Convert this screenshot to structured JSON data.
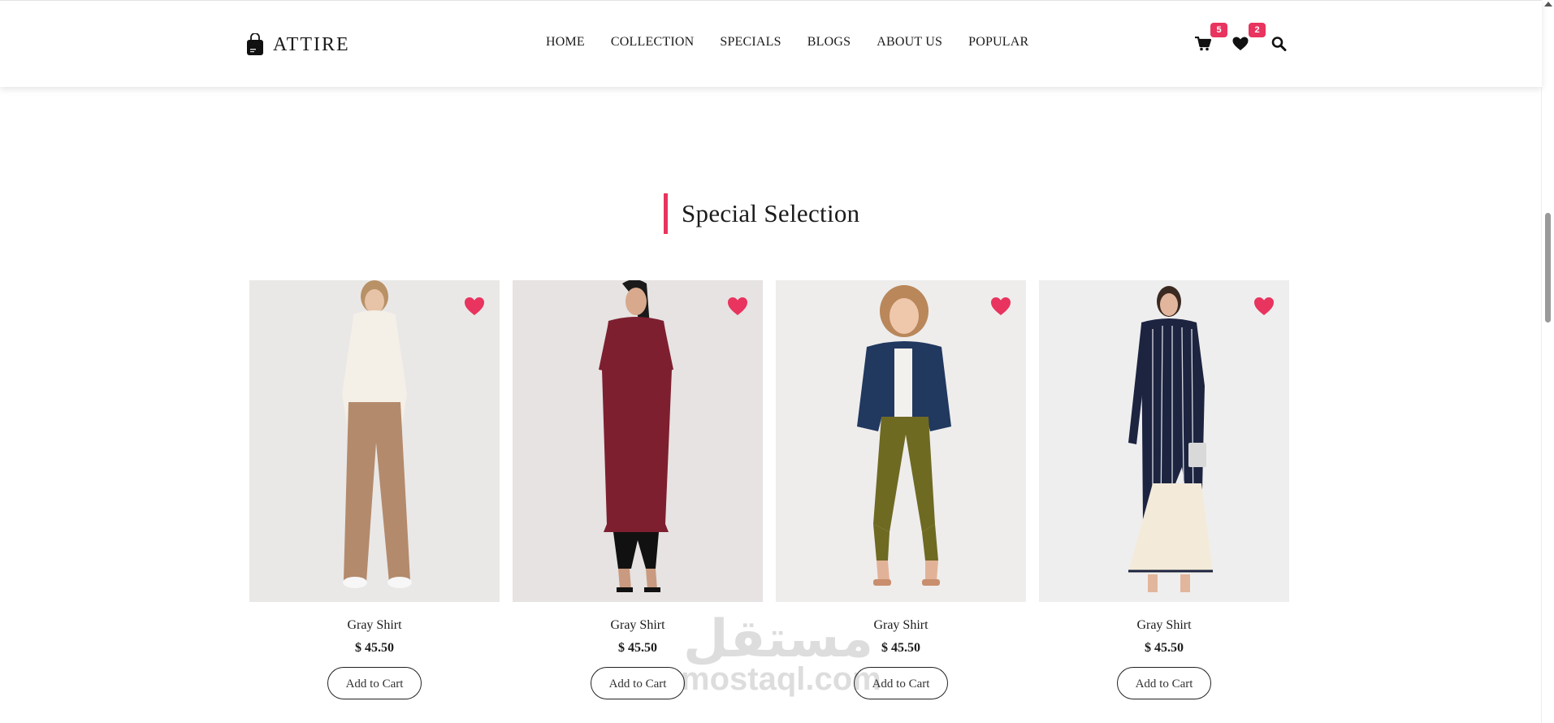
{
  "brand": {
    "name": "ATTIRE",
    "icon": "shopping-bag-icon"
  },
  "nav": {
    "items": [
      {
        "label": "HOME"
      },
      {
        "label": "COLLECTION"
      },
      {
        "label": "SPECIALS"
      },
      {
        "label": "BLOGS"
      },
      {
        "label": "ABOUT US"
      },
      {
        "label": "POPULAR"
      }
    ]
  },
  "header_icons": {
    "cart_count": "5",
    "wishlist_count": "2",
    "icons": [
      "cart-icon",
      "heart-icon",
      "search-icon"
    ]
  },
  "section": {
    "title": "Special Selection"
  },
  "products": [
    {
      "name": "Gray Shirt",
      "price": "$ 45.50",
      "button": "Add to Cart"
    },
    {
      "name": "Gray Shirt",
      "price": "$ 45.50",
      "button": "Add to Cart"
    },
    {
      "name": "Gray Shirt",
      "price": "$ 45.50",
      "button": "Add to Cart"
    },
    {
      "name": "Gray Shirt",
      "price": "$ 45.50",
      "button": "Add to Cart"
    }
  ],
  "watermark": {
    "arabic": "مستقل",
    "latin": "mostaql.com"
  },
  "colors": {
    "accent": "#e8345e",
    "text": "#1b1b1b",
    "background": "#ffffff"
  }
}
